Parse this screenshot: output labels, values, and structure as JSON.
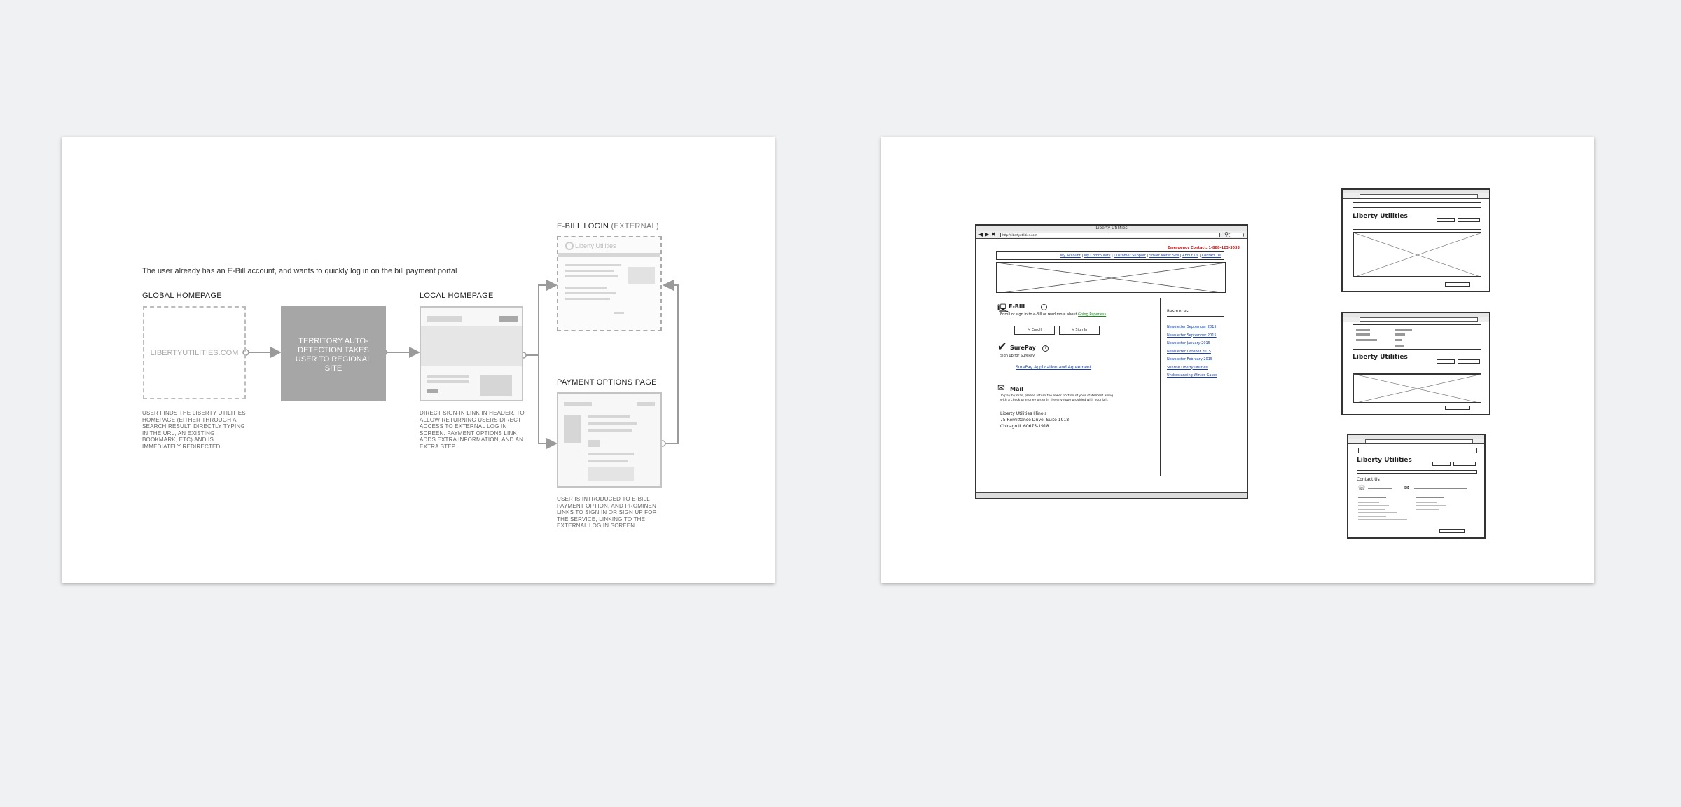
{
  "flow": {
    "intro": "The user already has an E-Bill account, and wants to quickly log in on the bill payment portal",
    "global_homepage": {
      "title": "GLOBAL HOMEPAGE",
      "box_label": "LIBERTYUTILITIES.COM",
      "description": "USER FINDS THE LIBERTY UTILITIES HOMEPAGE (EITHER THROUGH A SEARCH RESULT, DIRECTLY TYPING IN THE URL, AN EXISTING BOOKMARK, ETC) AND IS IMMEDIATELY REDIRECTED."
    },
    "territory": {
      "label": "TERRITORY AUTO-DETECTION TAKES USER TO REGIONAL SITE"
    },
    "local_homepage": {
      "title": "LOCAL HOMEPAGE",
      "description": "DIRECT SIGN-IN LINK IN HEADER, TO ALLOW RETURNING USERS DIRECT ACCESS TO EXTERNAL LOG IN SCREEN. PAYMENT OPTIONS LINK ADDS EXTRA INFORMATION, AND AN EXTRA STEP"
    },
    "ebill_login": {
      "title": "E-BILL LOGIN",
      "qualifier": "(EXTERNAL)",
      "logo_text": "Liberty Utilities"
    },
    "payment_options": {
      "title": "PAYMENT OPTIONS PAGE",
      "description": "USER IS INTRODUCED TO E-BILL PAYMENT OPTION, AND PROMINENT LINKS TO SIGN IN OR SIGN UP FOR THE SERVICE, LINKING TO THE EXTERNAL LOG IN SCREEN"
    },
    "colors": {
      "accent_gray": "#9a9a9a",
      "territory_fill": "#a6a6a6"
    }
  },
  "wireframe": {
    "window_title": "Liberty Utilities",
    "url": "http://libertyutilities.com",
    "emergency": "Emergency Contact: 1-888-123-3033",
    "nav": [
      "My Account",
      "My Community",
      "Customer Support",
      "Smart Meter Site",
      "About Us",
      "Contact Us"
    ],
    "ebill": {
      "title": "E-Bill",
      "text": "Enroll or sign in to e-Bill or read more about",
      "link": "Going Paperless",
      "enroll": "Enroll",
      "signin": "Sign In"
    },
    "surepay": {
      "title": "SurePay",
      "text": "Sign up for SurePay",
      "link": "SurePay Application and Agreement"
    },
    "mail": {
      "title": "Mail",
      "text": "To pay by mail, please return the lower portion of your statement along with a check or money order in the envelope provided with your bill.",
      "address": [
        "Liberty Utilities Illinois",
        "75 Remittance Drive, Suite 1918",
        "Chicago IL 60675-1918"
      ]
    },
    "resources": {
      "title": "Resources",
      "links": [
        "Newsletter September 2015",
        "Newsletter September 2015",
        "Newsletter January 2015",
        "Newsletter October 2015",
        "Newsletter February 2015",
        "Sunrise Liberty Utilities",
        "Understanding Winter Gases"
      ]
    },
    "small_brand": "Liberty Utilities",
    "contact_title": "Contact Us",
    "colors": {
      "link": "#1a3fa8",
      "emergency": "#d11a1a"
    }
  }
}
